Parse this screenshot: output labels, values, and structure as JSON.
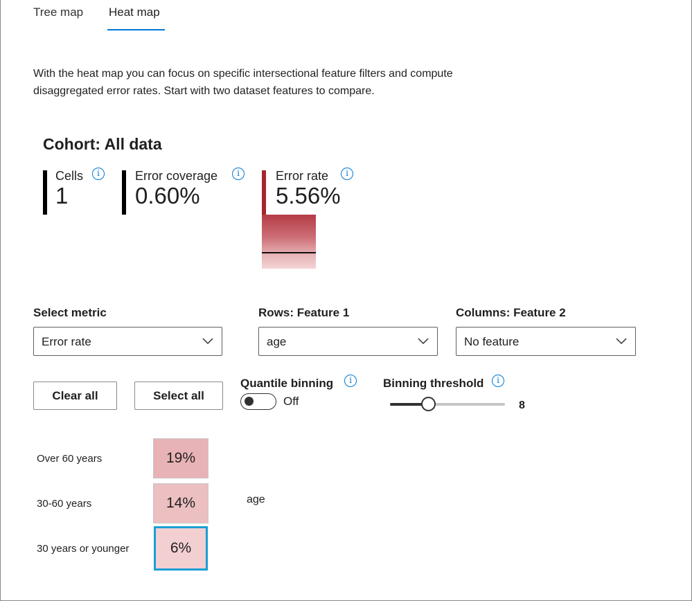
{
  "tabs": [
    {
      "label": "Tree map",
      "active": false
    },
    {
      "label": "Heat map",
      "active": true
    }
  ],
  "description": "With the heat map you can focus on specific intersectional feature filters and compute disaggregated error rates. Start with two dataset features to compare.",
  "cohort": {
    "title": "Cohort: All data",
    "kpis": [
      {
        "label": "Cells",
        "value": "1"
      },
      {
        "label": "Error coverage",
        "value": "0.60%"
      },
      {
        "label": "Error rate",
        "value": "5.56%"
      }
    ]
  },
  "controls": {
    "metric": {
      "label": "Select metric",
      "value": "Error rate"
    },
    "rows": {
      "label": "Rows: Feature 1",
      "value": "age"
    },
    "columns": {
      "label": "Columns: Feature 2",
      "value": "No feature"
    },
    "clear_all": "Clear all",
    "select_all": "Select all",
    "quantile_binning": {
      "label": "Quantile binning",
      "state": "Off"
    },
    "binning_threshold": {
      "label": "Binning threshold",
      "value": "8",
      "fraction": 0.33
    }
  },
  "heatmap": {
    "axis_label": "age",
    "rows": [
      {
        "label": "Over 60 years",
        "value": "19%",
        "color": "#e8b3b6",
        "selected": false
      },
      {
        "label": "30-60 years",
        "value": "14%",
        "color": "#ecbfc1",
        "selected": false
      },
      {
        "label": "30 years or younger",
        "value": "6%",
        "color": "#f3cfd1",
        "selected": true
      }
    ]
  },
  "colors": {
    "accent": "#0078d4",
    "error_bar": "#a4262c",
    "selected_cell_border": "#1a9ed4"
  }
}
